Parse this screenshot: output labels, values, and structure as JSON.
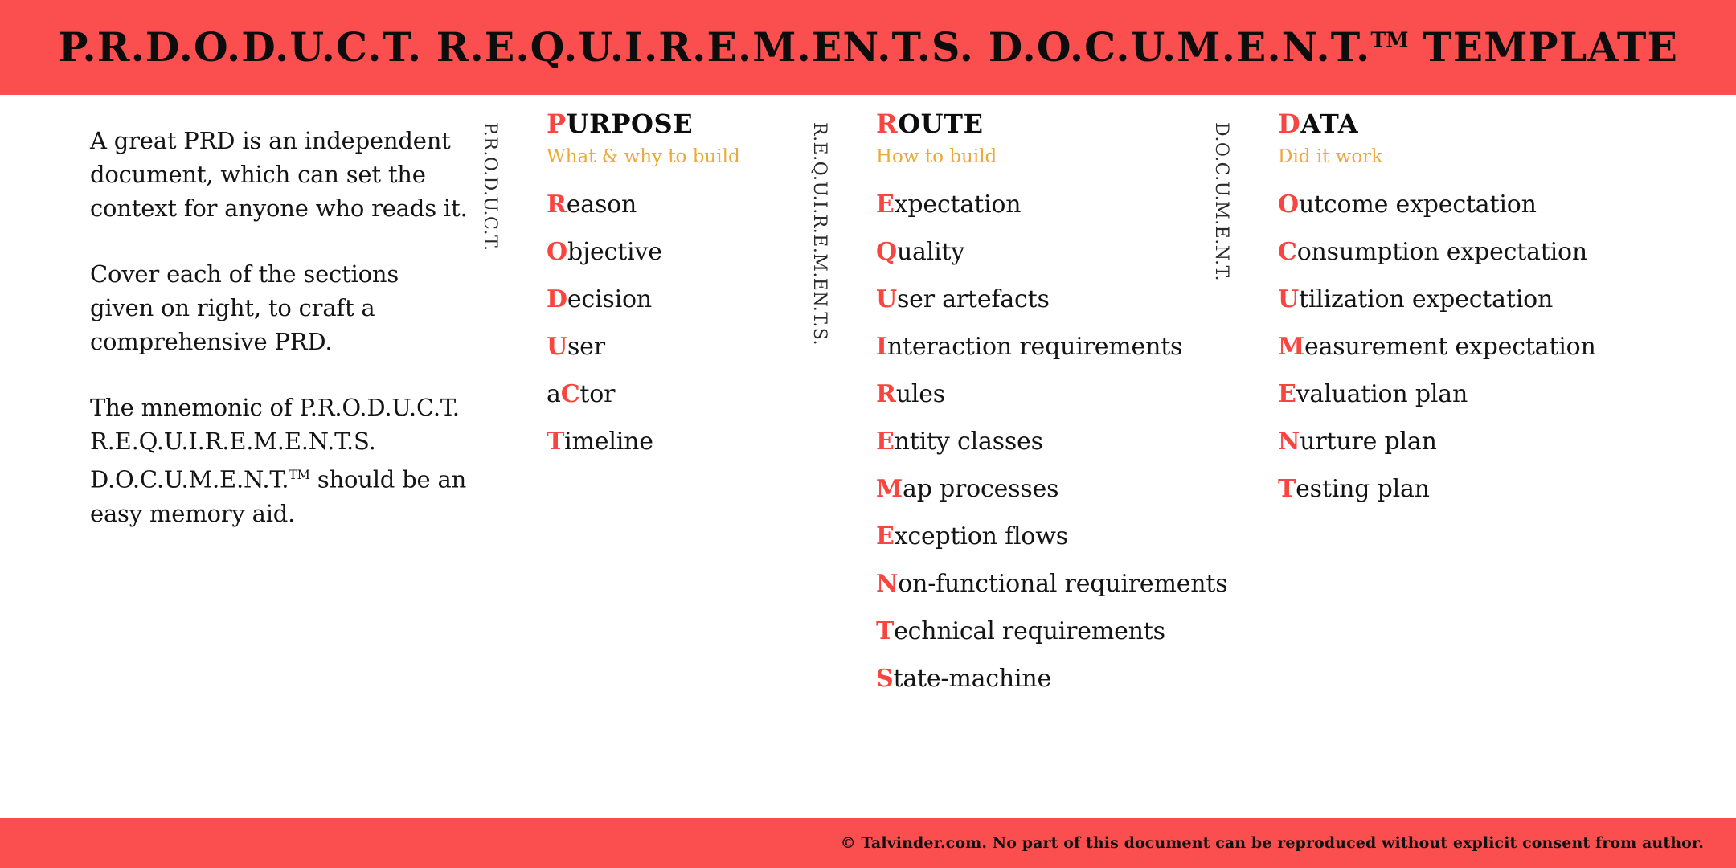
{
  "header": {
    "title_parts": [
      "P.R.D.O.D.U.C.T.",
      "R.E.Q.U.I.R.E.M.EN.T.S.",
      "D.O.C.U.M.E.N.T."
    ],
    "title_trademark": "TM",
    "title_suffix": "TEMPLATE",
    "background_color": "#fb4f4f",
    "text_color": "#0d0d0d"
  },
  "intro": {
    "paragraph_1": "A great PRD is an independent document, which can set the context for anyone who reads it.",
    "paragraph_2": "Cover each of the sections given on right, to craft a comprehensive PRD.",
    "paragraph_3_pre": "The mnemonic of P.R.O.D.U.C.T. R.E.Q.U.I.R.E.M.E.N.T.S. D.O.C.U.M.E.N.T.",
    "paragraph_3_tm": "TM",
    "paragraph_3_post": " should be an easy memory aid."
  },
  "colors": {
    "accent_red": "#f9453f",
    "bar_red": "#fb4f4f",
    "subtitle_gold": "#e9a93b",
    "body_text": "#141414"
  },
  "columns": [
    {
      "vertical_label": "P.R.O.D.U.C.T.",
      "title_lead": "P",
      "title_rest": "URPOSE",
      "subtitle": "What & why to build",
      "items": [
        {
          "pre": "",
          "lead": "R",
          "rest": "eason"
        },
        {
          "pre": "",
          "lead": "O",
          "rest": "bjective"
        },
        {
          "pre": "",
          "lead": "D",
          "rest": "ecision"
        },
        {
          "pre": "",
          "lead": "U",
          "rest": "ser"
        },
        {
          "pre": "a",
          "lead": "C",
          "rest": "tor"
        },
        {
          "pre": "",
          "lead": "T",
          "rest": "imeline"
        }
      ]
    },
    {
      "vertical_label": "R.E.Q.U.I.R.E.M.EN.T.S.",
      "title_lead": "R",
      "title_rest": "OUTE",
      "subtitle": "How to build",
      "items": [
        {
          "pre": "",
          "lead": "E",
          "rest": "xpectation"
        },
        {
          "pre": "",
          "lead": "Q",
          "rest": "uality"
        },
        {
          "pre": "",
          "lead": "U",
          "rest": "ser artefacts"
        },
        {
          "pre": "",
          "lead": "I",
          "rest": "nteraction requirements"
        },
        {
          "pre": "",
          "lead": "R",
          "rest": "ules"
        },
        {
          "pre": "",
          "lead": "E",
          "rest": "ntity classes"
        },
        {
          "pre": "",
          "lead": "M",
          "rest": "ap processes"
        },
        {
          "pre": "",
          "lead": "E",
          "rest": "xception flows"
        },
        {
          "pre": "",
          "lead": "N",
          "rest": "on-functional requirements"
        },
        {
          "pre": "",
          "lead": "T",
          "rest": "echnical requirements"
        },
        {
          "pre": "",
          "lead": "S",
          "rest": "tate-machine"
        }
      ]
    },
    {
      "vertical_label": "D.O.C.U.M.E.N.T.",
      "title_lead": "D",
      "title_rest": "ATA",
      "subtitle": "Did it work",
      "items": [
        {
          "pre": "",
          "lead": "O",
          "rest": "utcome expectation"
        },
        {
          "pre": "",
          "lead": "C",
          "rest": "onsumption expectation"
        },
        {
          "pre": "",
          "lead": "U",
          "rest": "tilization expectation"
        },
        {
          "pre": "",
          "lead": "M",
          "rest": "easurement expectation"
        },
        {
          "pre": "",
          "lead": "E",
          "rest": "valuation plan"
        },
        {
          "pre": "",
          "lead": "N",
          "rest": "urture plan"
        },
        {
          "pre": "",
          "lead": "T",
          "rest": "esting plan"
        }
      ]
    }
  ],
  "footer": {
    "copyright": "© Talvinder.com. No part of this document can be reproduced without explicit consent from author."
  }
}
